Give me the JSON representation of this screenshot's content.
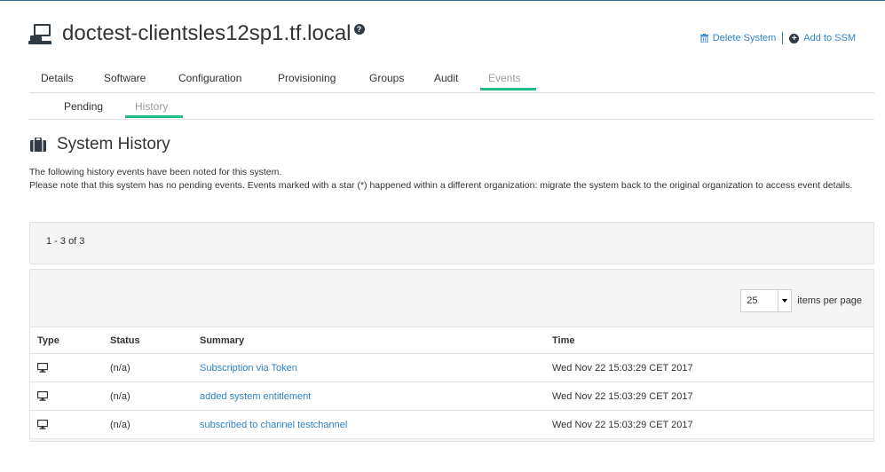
{
  "header": {
    "title": "doctest-clientsles12sp1.tf.local",
    "help_glyph": "?",
    "actions": {
      "delete_label": "Delete System",
      "add_label": "Add to SSM"
    }
  },
  "tabs": [
    {
      "label": "Details",
      "active": false
    },
    {
      "label": "Software",
      "active": false
    },
    {
      "label": "Configuration",
      "active": false
    },
    {
      "label": "Provisioning",
      "active": false
    },
    {
      "label": "Groups",
      "active": false
    },
    {
      "label": "Audit",
      "active": false
    },
    {
      "label": "Events",
      "active": true
    }
  ],
  "subtabs": [
    {
      "label": "Pending",
      "active": false
    },
    {
      "label": "History",
      "active": true
    }
  ],
  "section": {
    "title": "System History",
    "description_line1": "The following history events have been noted for this system.",
    "description_line2": "Please note that this system has no pending events. Events marked with a star (*) happened within a different organization: migrate the system back to the original organization to access event details."
  },
  "list": {
    "count_text": "1 - 3 of 3",
    "per_page_value": "25",
    "per_page_label": "items per page",
    "columns": {
      "type": "Type",
      "status": "Status",
      "summary": "Summary",
      "time": "Time"
    },
    "rows": [
      {
        "type_icon": "monitor-icon",
        "status": "(n/a)",
        "summary": "Subscription via Token",
        "time": "Wed Nov 22 15:03:29 CET 2017"
      },
      {
        "type_icon": "monitor-icon",
        "status": "(n/a)",
        "summary": "added system entitlement",
        "time": "Wed Nov 22 15:03:29 CET 2017"
      },
      {
        "type_icon": "monitor-icon",
        "status": "(n/a)",
        "summary": "subscribed to channel testchannel",
        "time": "Wed Nov 22 15:03:29 CET 2017"
      }
    ]
  },
  "colors": {
    "link": "#2f83c7",
    "active_underline": "#1fbd8a",
    "panel_bg": "#f4f4f4"
  }
}
